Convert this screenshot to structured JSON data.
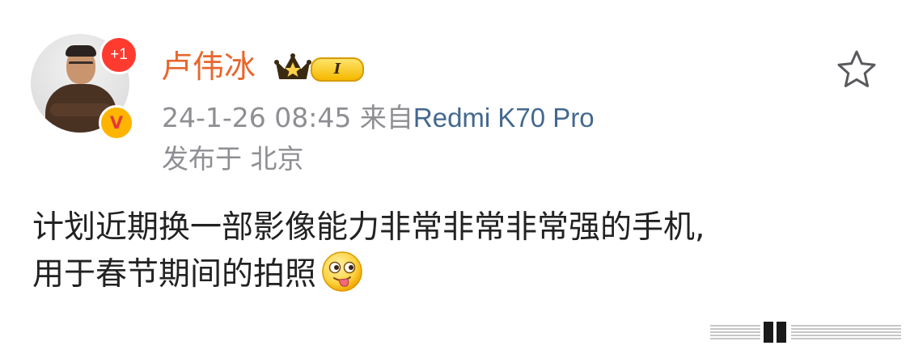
{
  "post": {
    "author": {
      "name": "卢伟冰",
      "notification_badge": "+1",
      "verified_mark": "V",
      "member_level": "I"
    },
    "meta": {
      "timestamp": "24-1-26 08:45",
      "source_prefix": "来自",
      "device": "Redmi K70 Pro",
      "location_prefix": "发布于",
      "location": "北京"
    },
    "text_lines": [
      "计划近期换一部影像能力非常非常非常强的手机,",
      "用于春节期间的拍照"
    ],
    "emoji": "tongue-out-emoji"
  },
  "colors": {
    "username": "#e8662d",
    "meta_gray": "#8e8e93",
    "device_link": "#43688f",
    "badge_red": "#ff3b30",
    "verified_gold": "#ffb400",
    "body_text": "#222222"
  },
  "icons": [
    "star-icon",
    "crown-icon",
    "verified-v-icon",
    "tongue-out-emoji",
    "watermark-icon"
  ]
}
